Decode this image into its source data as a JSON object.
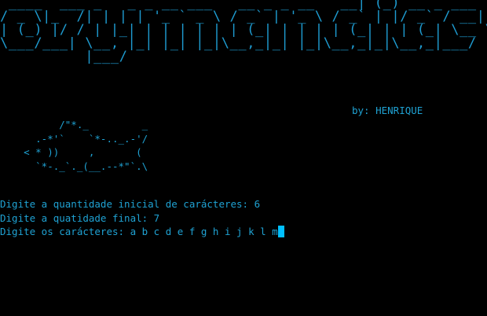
{
  "terminal": {
    "banner_ascii": " ____  ___ _   _ _ __ ___   __ _ _ __   __| (_) __ _ ___ \n/ _ \\|_  /| | | | '_ ` _ \\ / _` | '_ \\ / _` | |/ _` / __|\n| (_) |/ / | |_| | | | | | | (_| | | | | (_| | | (_| \\__ \\\n\\___/___| \\__, |_| |_| |_|\\__,_|_| |_|\\__,_|_|\\__,_|___/\n          |___/",
    "byline": "by: HENRIQUE",
    "fish_ascii": "          /\"*._         _\n      .-*'`    `*-.._.-'/\n    < * ))     ,       (\n      `*-._`._(__.--*\"`.\\",
    "lines": [
      "Digite a quantidade inicial de carácteres: 6",
      "Digite a quatidade final: 7",
      "Digite os carácteres: a b c d e f g h i j k l m"
    ]
  },
  "colors": {
    "background": "#000000",
    "text": "#1fa2d3",
    "cursor": "#00bfff"
  }
}
